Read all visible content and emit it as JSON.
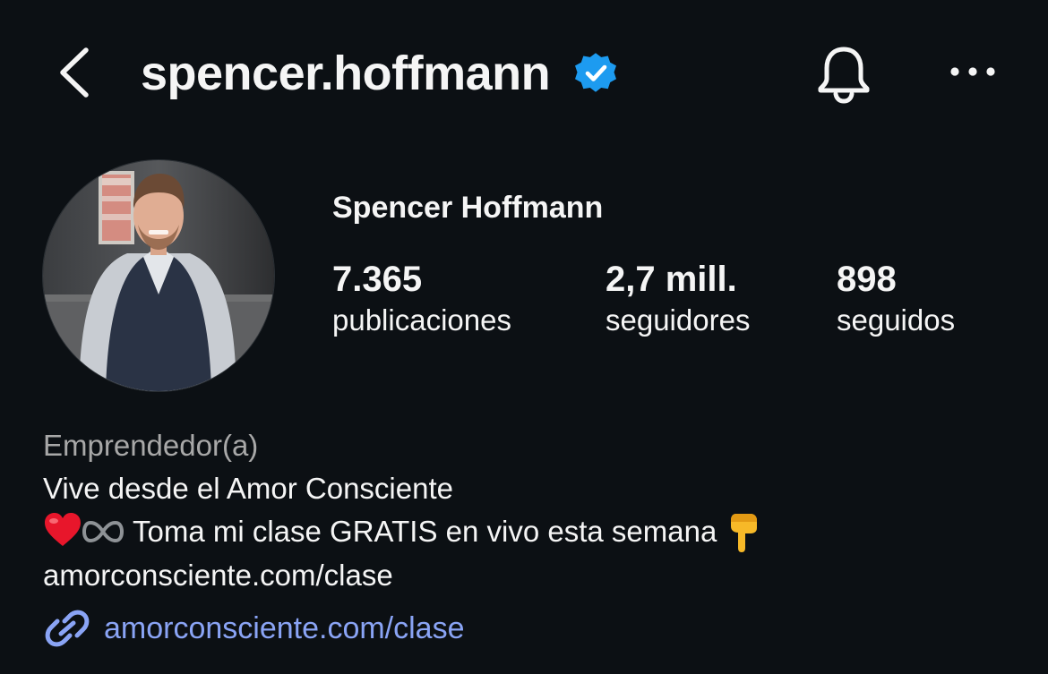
{
  "header": {
    "username": "spencer.hoffmann",
    "icons": {
      "back": "chevron-left-icon",
      "verified": "verified-badge-icon",
      "notifications": "bell-icon",
      "more": "more-horizontal-icon"
    },
    "verified_color": "#1d9bf0"
  },
  "profile": {
    "full_name": "Spencer Hoffmann",
    "avatar": "profile-photo"
  },
  "stats": {
    "posts": {
      "value": "7.365",
      "label": "publicaciones"
    },
    "followers": {
      "value": "2,7 mill.",
      "label": "seguidores"
    },
    "following": {
      "value": "898",
      "label": "seguidos"
    }
  },
  "bio": {
    "category": "Emprendedor(a)",
    "line1": "Vive desde el Amor Consciente",
    "line2_text": "Toma mi clase GRATIS en vivo esta semana",
    "line2_emojis": [
      "red-heart-emoji",
      "infinity-emoji",
      "pointing-down-emoji"
    ],
    "line3": "amorconsciente.com/clase"
  },
  "link": {
    "icon": "link-icon",
    "text": "amorconsciente.com/clase",
    "color": "#8aa4f5"
  },
  "colors": {
    "background": "#0c1014",
    "text": "#f5f5f5",
    "secondary_text": "#a8a8a8"
  }
}
